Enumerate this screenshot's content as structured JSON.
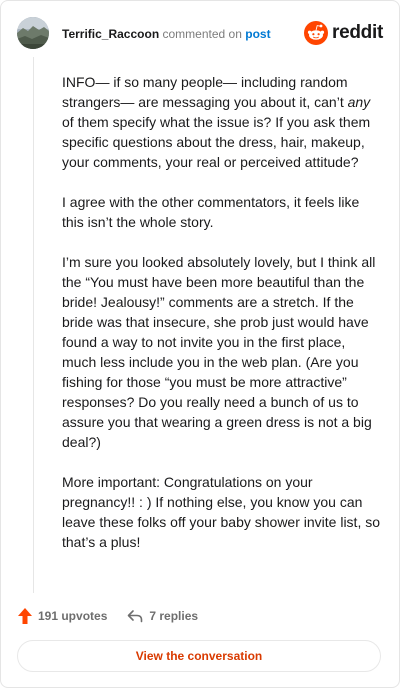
{
  "comment": {
    "username": "Terrific_Raccoon",
    "commented_on_text": "commented on",
    "post_link_text": "post",
    "paragraphs": [
      [
        "INFO— if so many people— including random strangers— are messaging you about it, can’t ",
        "any",
        " of them specify what the issue is? If you ask them specific questions about the dress, hair, makeup, your comments, your real or perceived attitude?"
      ],
      [
        "I agree with the other commentators, it feels like this isn’t the whole story."
      ],
      [
        "I’m sure you looked absolutely lovely, but I think all the “You must have been more beautiful than the bride! Jealousy!” comments are a stretch. If the bride was that insecure, she prob just would have found a way to not invite you in the first place, much less include you in the web plan. (Are you fishing for those “you must be more attractive” responses? Do you really need a bunch of us to assure you that wearing a green dress is not a big deal?)"
      ],
      [
        "More important: Congratulations on your pregnancy!! : ) If nothing else, you know you can leave these folks off your baby shower invite list, so that’s a plus!"
      ]
    ]
  },
  "brand": {
    "wordmark": "reddit",
    "logo_icon": "reddit-snoo-icon",
    "color": "#ff4500"
  },
  "footer": {
    "upvotes_label": "191 upvotes",
    "replies_label": "7 replies",
    "upvote_icon": "upvote-arrow-icon",
    "reply_icon": "reply-arrow-icon",
    "upvote_color": "#ff4500"
  },
  "cta": {
    "label": "View the conversation",
    "color": "#d93a00"
  }
}
